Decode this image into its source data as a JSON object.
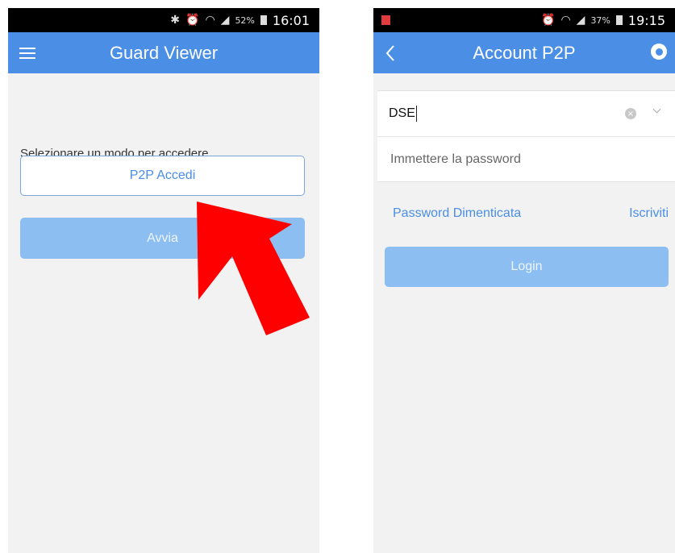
{
  "left_screen": {
    "status_bar": {
      "icons": [
        "bluetooth-icon",
        "alarm-icon",
        "wifi-icon",
        "signal-icon"
      ],
      "battery_percent": "52%",
      "time": "16:01"
    },
    "app_bar": {
      "title": "Guard Viewer",
      "menu_icon": "hamburger-menu-icon"
    },
    "prompt_text": "Selezionare un modo per accedere.",
    "p2p_button_label": "P2P Accedi",
    "start_button_label": "Avvia",
    "annotation": {
      "type": "red-arrow",
      "color": "#ff0000",
      "points_to": "P2P Accedi"
    }
  },
  "right_screen": {
    "status_bar": {
      "icons": [
        "notification-icon",
        "alarm-icon",
        "wifi-icon",
        "signal-icon"
      ],
      "battery_percent": "37%",
      "time": "19:15"
    },
    "app_bar": {
      "title": "Account P2P",
      "back_icon": "back-arrow-icon",
      "globe_icon": "globe-icon"
    },
    "form": {
      "username_value": "DSE",
      "password_placeholder": "Immettere la password"
    },
    "forgot_password_label": "Password Dimenticata",
    "register_label": "Iscriviti",
    "login_button_label": "Login"
  },
  "colors": {
    "app_bar": "#4a8ee6",
    "button_disabled": "#8cbef2",
    "link": "#4a8ee6",
    "background": "#f2f2f2"
  }
}
